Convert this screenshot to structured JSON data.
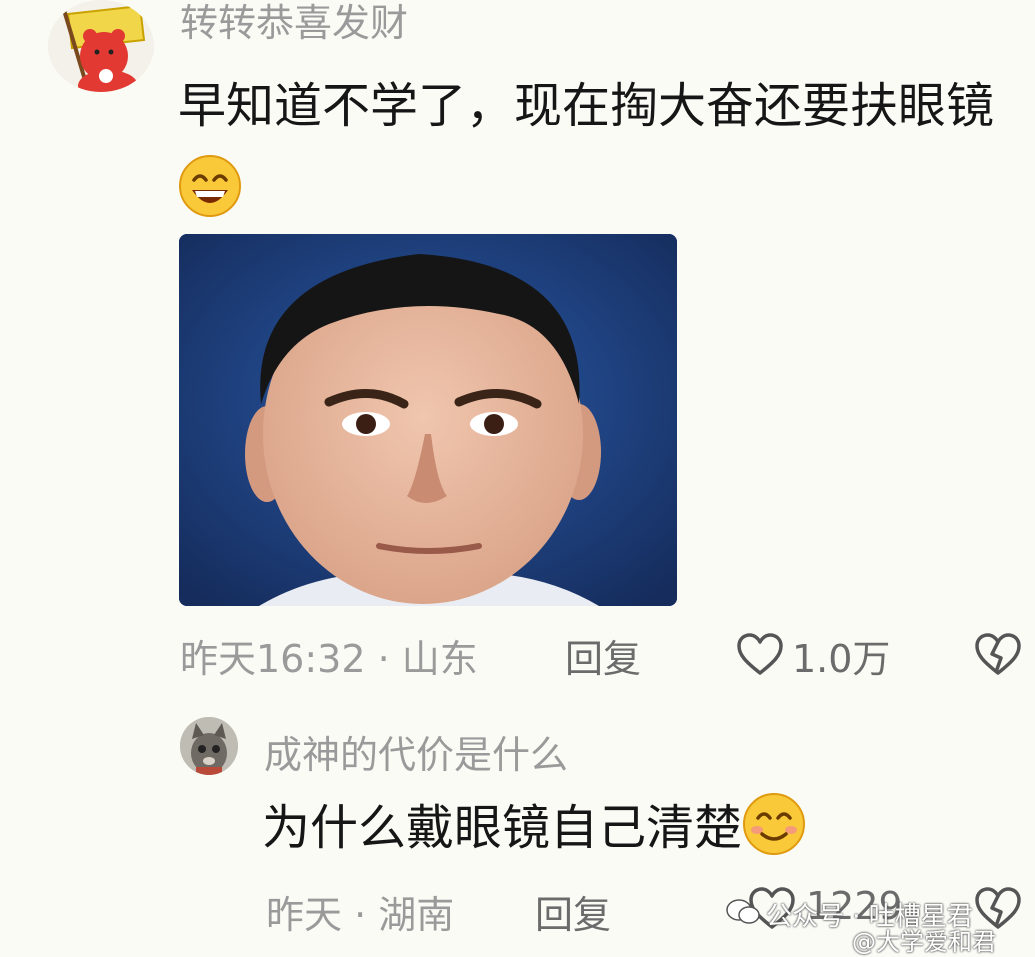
{
  "comments": [
    {
      "username": "转转恭喜发财",
      "text": "早知道不学了，现在掏大奋还要扶眼镜",
      "time_location": "昨天16:32 · 山东",
      "reply_label": "回复",
      "likes": "1.0万",
      "avatar_icon": "red-bear-flag-avatar",
      "emoji_icon": "grinning-face-icon"
    },
    {
      "username": "成神的代价是什么",
      "text": "为什么戴眼镜自己清楚",
      "time_location": "昨天 · 湖南",
      "reply_label": "回复",
      "likes": "1229",
      "avatar_icon": "cat-avatar",
      "emoji_icon": "smiling-face-icon"
    }
  ],
  "watermark": {
    "line1": "公众号 · 吐槽星君",
    "line2": "@大学爱和君"
  },
  "colors": {
    "background": "#fbfbf6",
    "meta_text": "#9a9a9a",
    "body_text": "#161616"
  }
}
